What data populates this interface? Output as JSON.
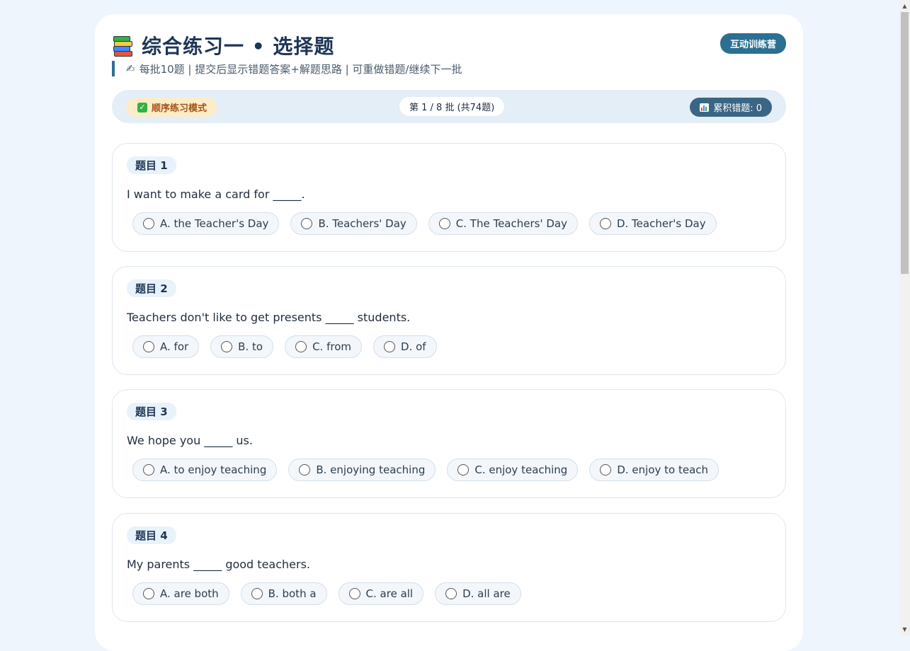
{
  "header": {
    "title": "综合练习一 • 选择题",
    "badge": "互动训练营",
    "subtitle": "每批10题 | 提交后显示错题答案+解题思路 | 可重做错题/继续下一批"
  },
  "status": {
    "mode": "顺序练习模式",
    "batch": "第 1 / 8 批 (共74题)",
    "wrong": "累积错题: 0"
  },
  "questions": [
    {
      "label": "题目 1",
      "text": "I want to make a card for _____.",
      "options": [
        "A. the Teacher's Day",
        "B. Teachers' Day",
        "C. The Teachers' Day",
        "D. Teacher's Day"
      ]
    },
    {
      "label": "题目 2",
      "text": "Teachers don't like to get presents _____ students.",
      "options": [
        "A. for",
        "B. to",
        "C. from",
        "D. of"
      ]
    },
    {
      "label": "题目 3",
      "text": "We hope you _____ us.",
      "options": [
        "A. to enjoy teaching",
        "B. enjoying teaching",
        "C. enjoy teaching",
        "D. enjoy to teach"
      ]
    },
    {
      "label": "题目 4",
      "text": "My parents _____ good teachers.",
      "options": [
        "A. are both",
        "B. both a",
        "C. are all",
        "D. all are"
      ]
    }
  ],
  "icons": {
    "title": "books-icon",
    "subtitle": "pencil-icon",
    "mode": "check-icon",
    "wrong": "chart-icon",
    "option": "radio-icon"
  },
  "colors": {
    "accent": "#2b6f93",
    "mode_bg": "#fdecc8",
    "mode_text": "#a4531a",
    "wrong_bg": "#3b6584",
    "page_bg": "#eef5fc"
  }
}
